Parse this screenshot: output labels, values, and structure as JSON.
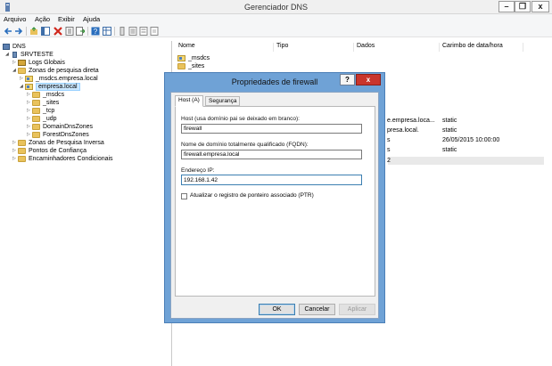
{
  "window": {
    "title": "Gerenciador DNS",
    "min_glyph": "–",
    "max_glyph": "❐",
    "close_glyph": "x"
  },
  "menu": {
    "items": [
      "Arquivo",
      "Ação",
      "Exibir",
      "Ajuda"
    ]
  },
  "tree": {
    "items": [
      {
        "label": "DNS",
        "icon": "dns-icon"
      },
      {
        "label": "SRVTESTE",
        "icon": "server-icon"
      },
      {
        "label": "Logs Globais",
        "icon": "logs-icon"
      },
      {
        "label": "Zonas de pesquisa direta",
        "icon": "folder-icon"
      },
      {
        "label": "_msdcs.empresa.local",
        "icon": "zone-icon"
      },
      {
        "label": "empresa.local",
        "icon": "zone-icon"
      },
      {
        "label": "_msdcs",
        "icon": "folder-icon"
      },
      {
        "label": "_sites",
        "icon": "folder-icon"
      },
      {
        "label": "_tcp",
        "icon": "folder-icon"
      },
      {
        "label": "_udp",
        "icon": "folder-icon"
      },
      {
        "label": "DomainDnsZones",
        "icon": "folder-icon"
      },
      {
        "label": "ForestDnsZones",
        "icon": "folder-icon"
      },
      {
        "label": "Zonas de Pesquisa Inversa",
        "icon": "folder-icon"
      },
      {
        "label": "Pontos de Confiança",
        "icon": "folder-icon"
      },
      {
        "label": "Encaminhadores Condicionais",
        "icon": "folder-icon"
      }
    ]
  },
  "list": {
    "columns": [
      "Nome",
      "Tipo",
      "Dados",
      "Carimbo de data/hora"
    ],
    "rows": [
      {
        "name": "_msdcs"
      },
      {
        "name": "_sites"
      }
    ],
    "partial_rows": [
      {
        "data": "e.empresa.loca...",
        "stamp": "static"
      },
      {
        "data": "presa.local.",
        "stamp": "static"
      },
      {
        "data": "s",
        "stamp": "26/05/2015 10:00:00"
      },
      {
        "data": "s",
        "stamp": "static"
      },
      {
        "data": "2",
        "stamp": ""
      }
    ]
  },
  "dialog": {
    "title": "Propriedades de firewall",
    "help_label": "?",
    "close_label": "x",
    "tabs": [
      "Host (A)",
      "Segurança"
    ],
    "host_label": "Host (usa domínio pai se deixado em branco):",
    "host_value": "firewall",
    "fqdn_label": "Nome de domínio totalmente qualificado (FQDN):",
    "fqdn_value": "firewall.empresa.local",
    "ip_label": "Endereço IP:",
    "ip_value": "192.168.1.42",
    "ptr_label": "Atualizar o registro de ponteiro associado (PTR)",
    "ptr_checked": false,
    "ok_label": "OK",
    "cancel_label": "Cancelar",
    "apply_label": "Aplicar"
  }
}
